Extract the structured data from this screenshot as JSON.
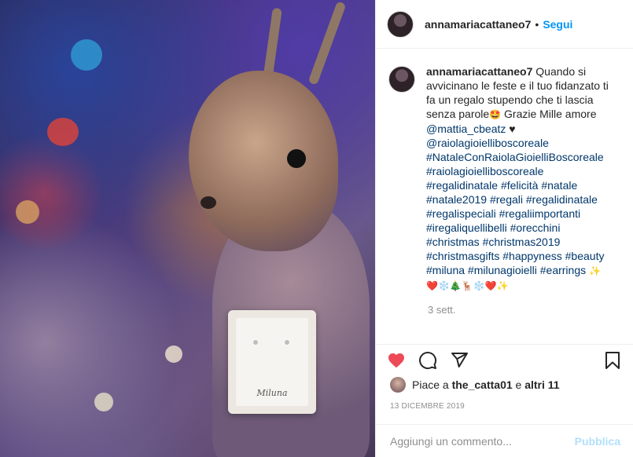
{
  "post": {
    "username": "annamariacattaneo7",
    "follow_separator": "•",
    "follow_label": "Segui"
  },
  "photo": {
    "brand_text": "Miluna"
  },
  "caption": {
    "username": "annamariacattaneo7",
    "text": "Quando si avvicinano le feste e il tuo fidanzato ti fa un regalo stupendo che ti lascia senza parole",
    "emoji_1": "🤩",
    "text_2": "Grazie Mille amore",
    "mention": "@mattia_cbeatz",
    "heart": "♥",
    "hashtags": [
      "@raiolagioielliboscoreale",
      "#NataleConRaiolaGioielliBoscoreale",
      "#raiolagioielliboscoreale",
      "#regalidinatale #felicità #natale",
      "#natale2019 #regali #regalidinatale",
      "#regalispeciali #regaliimportanti",
      "#iregaliquellibelli #orecchini",
      "#christmas #christmas2019",
      "#christmasgifts #happyness #beauty",
      "#miluna #milunagioielli #earrings"
    ],
    "trailing_sparkle": "✨",
    "emoji_line": "❤️❄️🎄🦌❄️❤️✨",
    "time_ago": "3 sett."
  },
  "actions": {
    "like_icon": "heart-filled-icon",
    "comment_icon": "comment-icon",
    "share_icon": "share-icon",
    "save_icon": "bookmark-icon"
  },
  "likes": {
    "prefix": "Piace a",
    "user": "the_catta01",
    "middle": "e",
    "others": "altri 11"
  },
  "date": "13 DICEMBRE 2019",
  "comment_box": {
    "placeholder": "Aggiungi un commento...",
    "publish_label": "Pubblica"
  },
  "colors": {
    "accent": "#0095f6",
    "like": "#ed4956",
    "publish_disabled": "#b2dffc",
    "hashtag": "#00376b"
  }
}
